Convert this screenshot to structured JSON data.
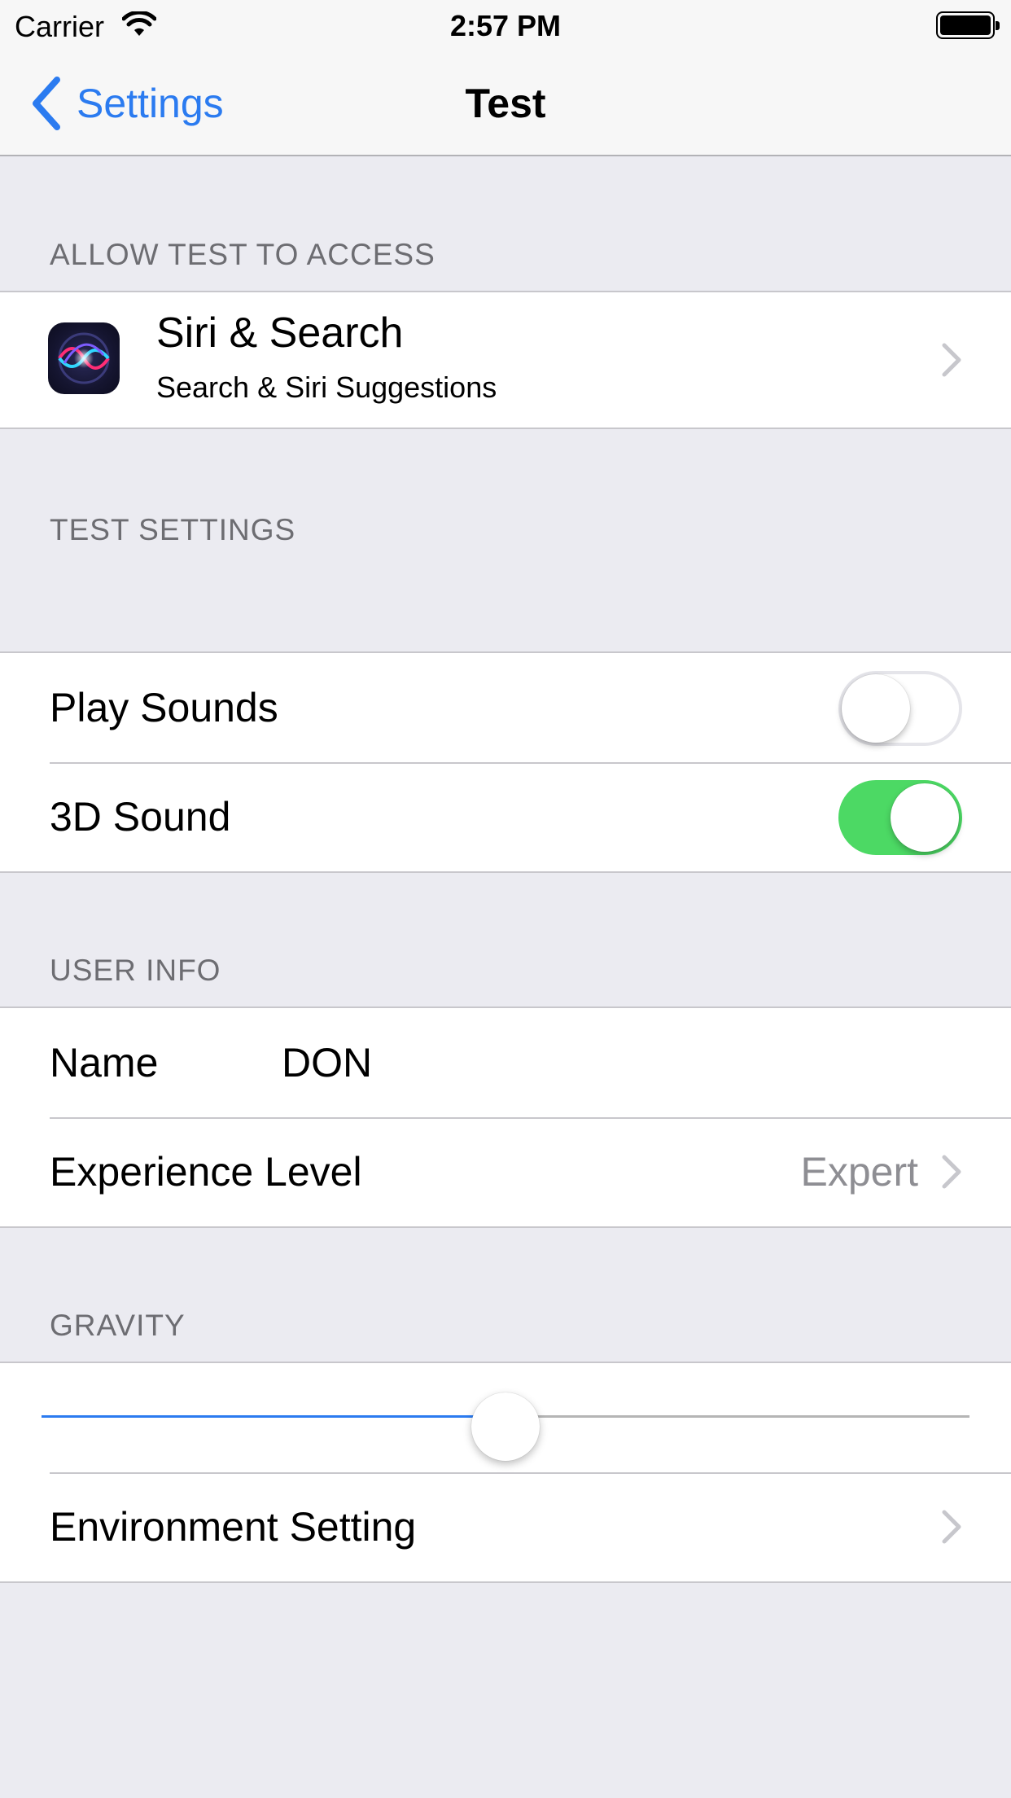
{
  "status_bar": {
    "carrier": "Carrier",
    "time": "2:57 PM"
  },
  "nav": {
    "back_label": "Settings",
    "title": "Test"
  },
  "sections": {
    "access": {
      "header": "ALLOW TEST TO ACCESS",
      "siri": {
        "title": "Siri & Search",
        "subtitle": "Search & Siri Suggestions",
        "icon": "siri-icon"
      }
    },
    "test_settings": {
      "header": "TEST SETTINGS",
      "play_sounds": {
        "label": "Play Sounds",
        "enabled": false
      },
      "sound_3d": {
        "label": "3D Sound",
        "enabled": true
      }
    },
    "user_info": {
      "header": "USER INFO",
      "name": {
        "label": "Name",
        "value": "DON"
      },
      "experience": {
        "label": "Experience Level",
        "value": "Expert"
      }
    },
    "gravity": {
      "header": "GRAVITY",
      "slider_value": 0.5,
      "environment": {
        "label": "Environment Setting"
      }
    }
  },
  "colors": {
    "accent": "#2b7bf0",
    "toggle_on": "#4cd964",
    "background": "#ebebf1"
  }
}
